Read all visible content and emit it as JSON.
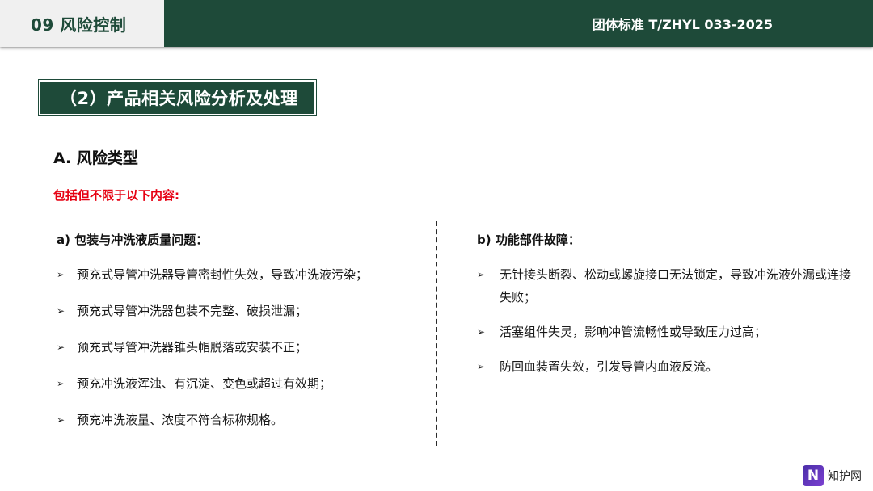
{
  "header": {
    "section": "09  风险控制",
    "standard": "团体标准   T/ZHYL 033-2025"
  },
  "title": "（2）产品相关风险分析及处理",
  "section_a": "A. 风险类型",
  "note": "包括但不限于以下内容:",
  "left": {
    "heading": "a) 包装与冲洗液质量问题：",
    "bullet": "➢",
    "items": [
      "预充式导管冲洗器导管密封性失效，导致冲洗液污染；",
      "预充式导管冲洗器包装不完整、破损泄漏；",
      "预充式导管冲洗器锥头帽脱落或安装不正；",
      "预充冲洗液浑浊、有沉淀、变色或超过有效期；",
      "预充冲洗液量、浓度不符合标称规格。"
    ]
  },
  "right": {
    "heading": "b) 功能部件故障：",
    "bullet": "➢",
    "items": [
      "无针接头断裂、松动或螺旋接口无法锁定，导致冲洗液外漏或连接失败；",
      "活塞组件失灵，影响冲管流畅性或导致压力过高；",
      "防回血装置失效，引发导管内血液反流。"
    ]
  },
  "watermark": {
    "logo": "N",
    "text": "知护网"
  }
}
